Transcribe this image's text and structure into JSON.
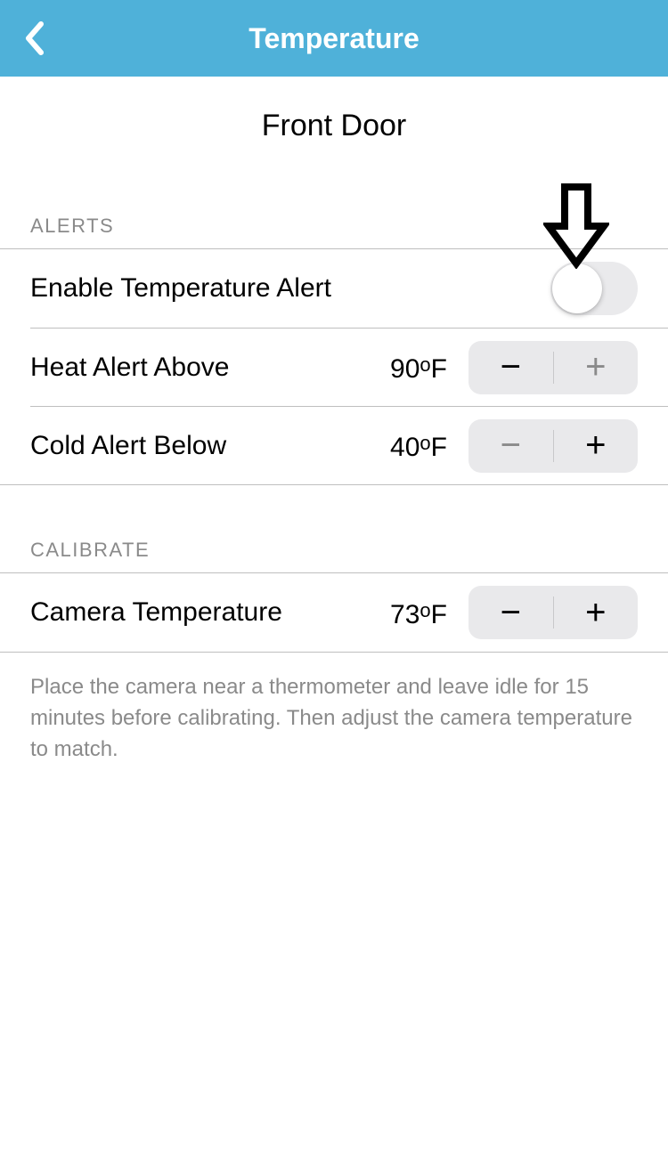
{
  "header": {
    "title": "Temperature"
  },
  "device_name": "Front Door",
  "sections": {
    "alerts": {
      "heading": "ALERTS",
      "enable_label": "Enable Temperature Alert",
      "enable_value": false,
      "heat": {
        "label": "Heat Alert Above",
        "value": 90,
        "unit": "F"
      },
      "cold": {
        "label": "Cold Alert Below",
        "value": 40,
        "unit": "F"
      }
    },
    "calibrate": {
      "heading": "CALIBRATE",
      "camera": {
        "label": "Camera Temperature",
        "value": 73,
        "unit": "F"
      },
      "footnote": "Place the camera near a thermometer and leave idle for 15 minutes before calibrating. Then adjust the camera temperature to match."
    }
  },
  "icons": {
    "back": "chevron-left",
    "minus": "−",
    "plus": "+"
  },
  "annotation": {
    "arrow": "down-arrow"
  }
}
